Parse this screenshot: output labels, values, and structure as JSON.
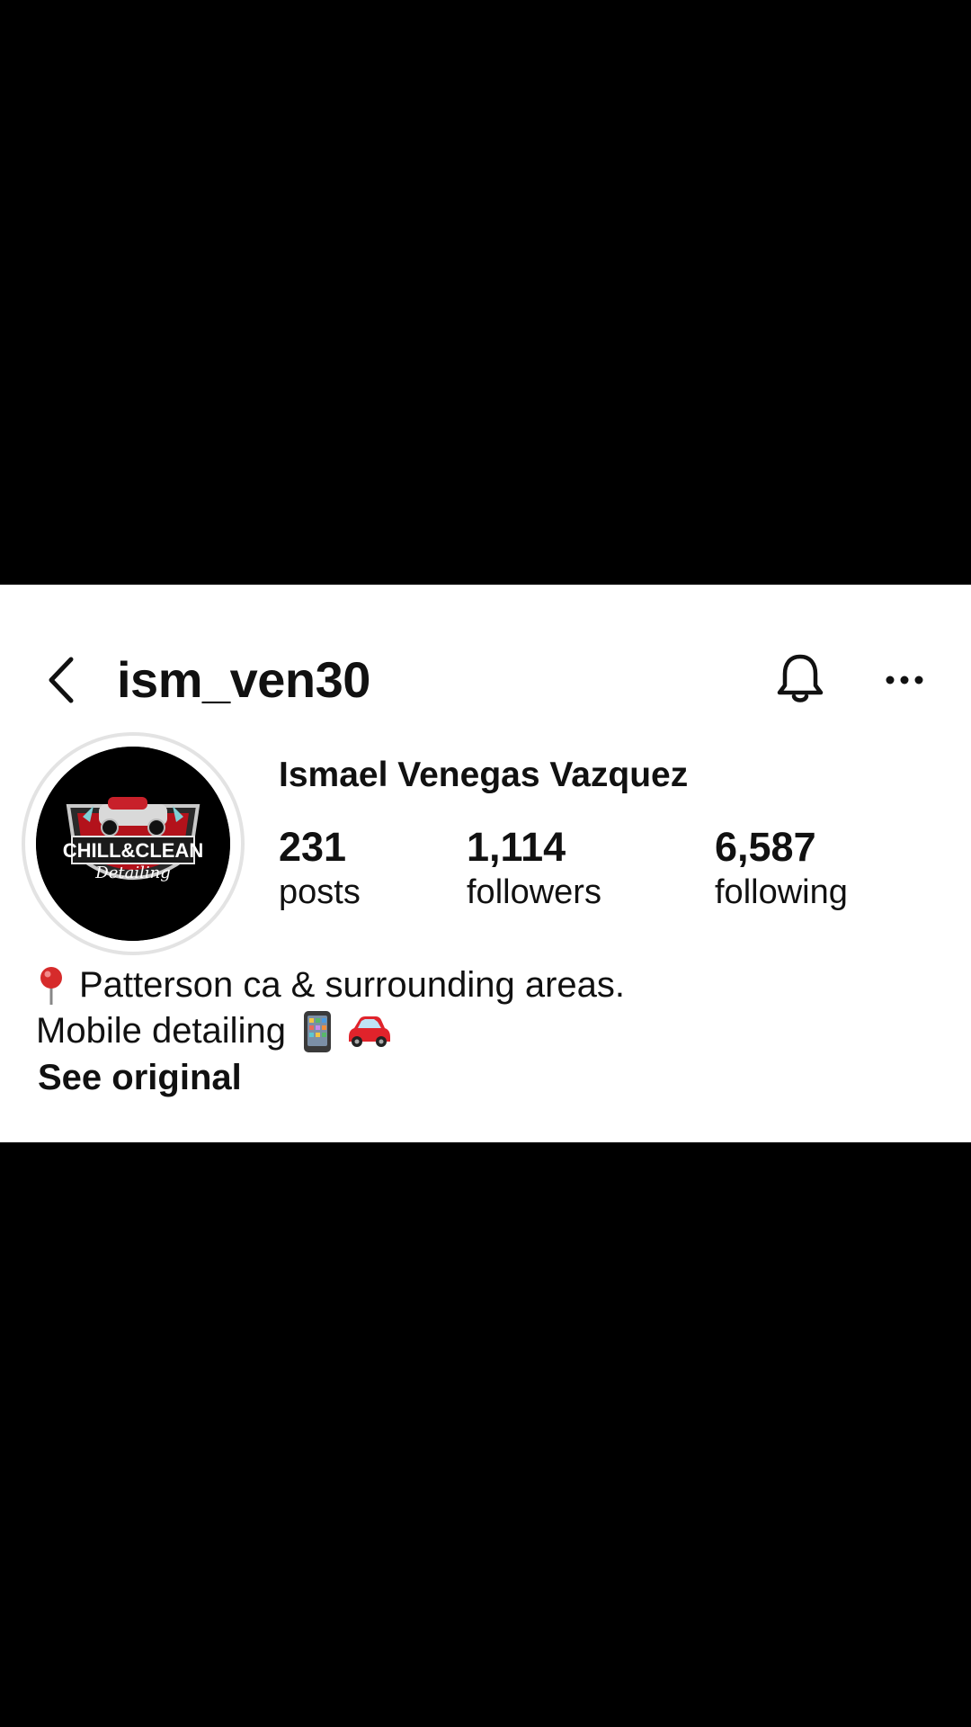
{
  "header": {
    "username": "ism_ven30",
    "back_icon": "chevron-left-icon",
    "notification_icon": "bell-icon",
    "more_icon": "more-horizontal-icon"
  },
  "profile": {
    "display_name": "Ismael Venegas Vazquez",
    "avatar_text": "CHILL & CLEAN Detailing",
    "stats": [
      {
        "value": "231",
        "label": "posts"
      },
      {
        "value": "1,114",
        "label": "followers"
      },
      {
        "value": "6,587",
        "label": "following"
      }
    ],
    "bio_line1": "Patterson ca & surrounding areas.",
    "bio_line2": "Mobile detailing",
    "see_original": "See original"
  },
  "colors": {
    "background": "#000000",
    "panel": "#ffffff",
    "text": "#111111",
    "avatar_ring": "#e3e3e3",
    "pin_red": "#d62b2b",
    "car_red": "#e0232b"
  }
}
